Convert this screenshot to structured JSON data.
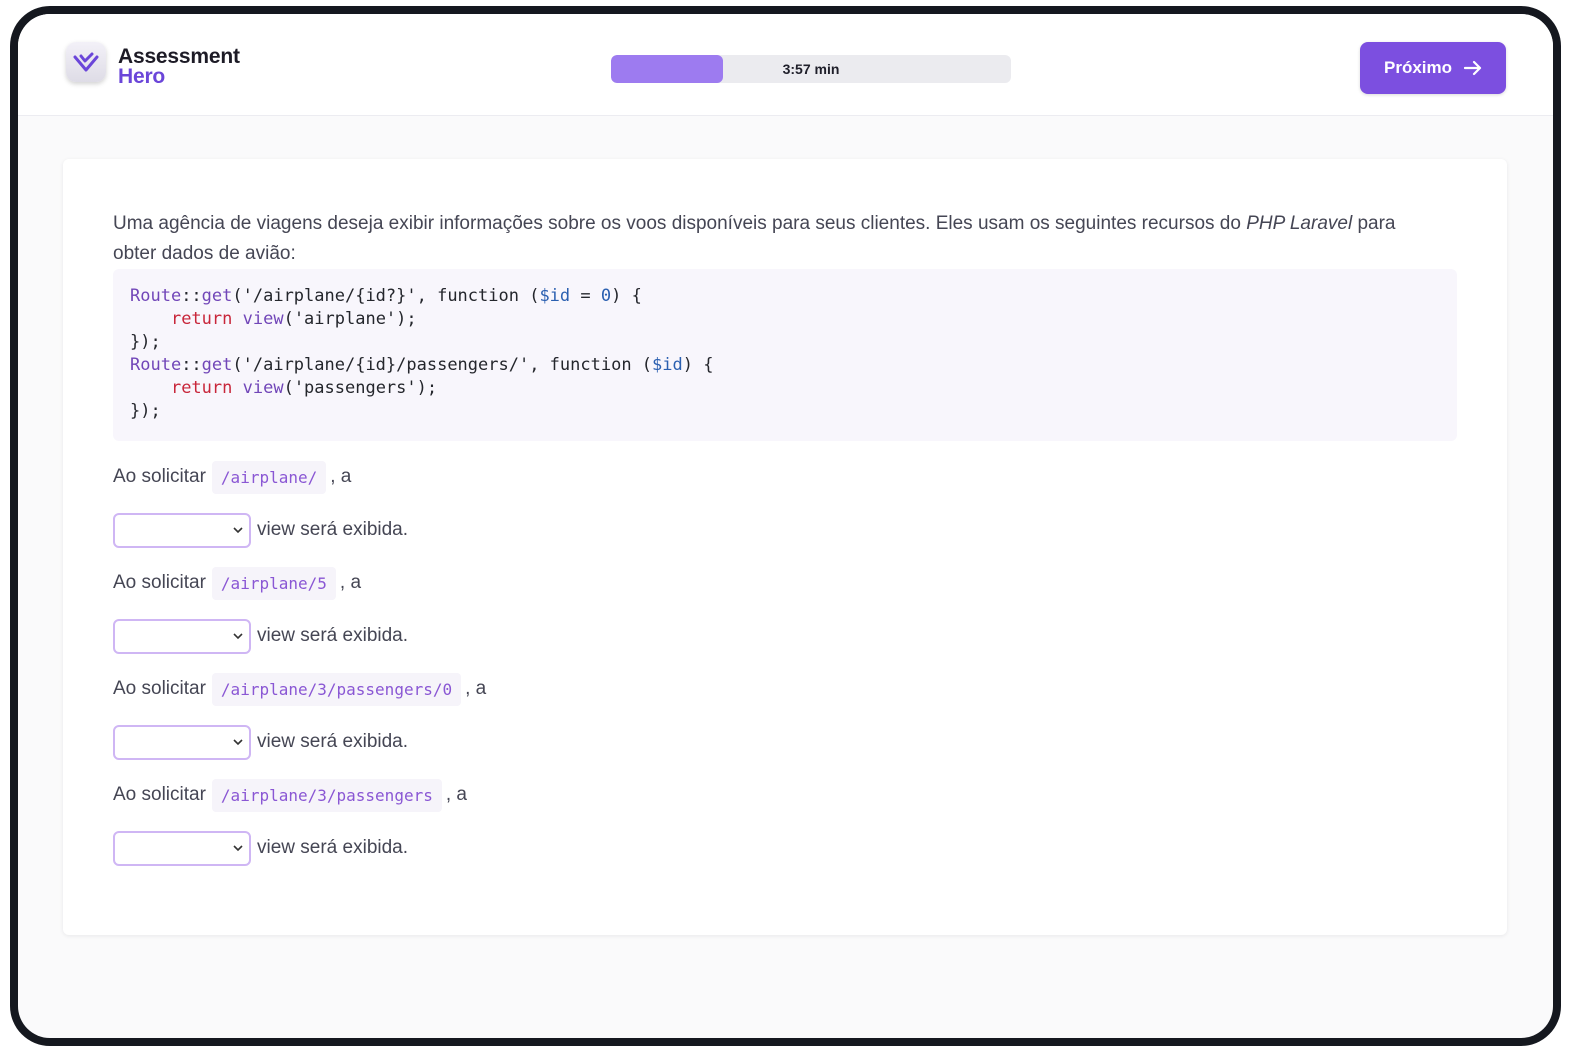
{
  "brand": {
    "line1": "Assessment",
    "line2": "Hero",
    "logo_icon": "heart-check-icon"
  },
  "timer": {
    "label": "3:57 min",
    "progress": 0.28
  },
  "next_button": {
    "label": "Próximo",
    "icon": "arrow-right-icon"
  },
  "question": {
    "prompt_before": "Uma agência de viagens deseja exibir informações sobre os voos disponíveis para seus clientes. Eles usam os seguintes recursos do ",
    "prompt_emph": "PHP Laravel",
    "prompt_after": " para obter dados de avião:",
    "code": {
      "l1": {
        "cls": "Route",
        "op": "::",
        "fn": "get",
        "a": "('/airplane/{id?}', function (",
        "v": "$id",
        "b": " = ",
        "num": "0",
        "c": ") {"
      },
      "l2": {
        "ret": "return",
        "fn": "view",
        "a": "('airplane');"
      },
      "l3": "});",
      "l4": {
        "cls": "Route",
        "op": "::",
        "fn": "get",
        "a": "('/airplane/{id}/passengers/', function (",
        "v": "$id",
        "c": ") {"
      },
      "l5": {
        "ret": "return",
        "fn": "view",
        "a": "('passengers');"
      },
      "l6": "});"
    },
    "items": [
      {
        "prefix": "Ao solicitar",
        "path": "/airplane/",
        "suffix": ", a",
        "select_value": "",
        "after_select": "view será exibida."
      },
      {
        "prefix": "Ao solicitar",
        "path": "/airplane/5",
        "suffix": ", a",
        "select_value": "",
        "after_select": "view será exibida."
      },
      {
        "prefix": "Ao solicitar",
        "path": "/airplane/3/passengers/0",
        "suffix": ", a",
        "select_value": "",
        "after_select": "view será exibida."
      },
      {
        "prefix": "Ao solicitar",
        "path": "/airplane/3/passengers",
        "suffix": ", a",
        "select_value": "",
        "after_select": "view será exibida."
      }
    ]
  }
}
